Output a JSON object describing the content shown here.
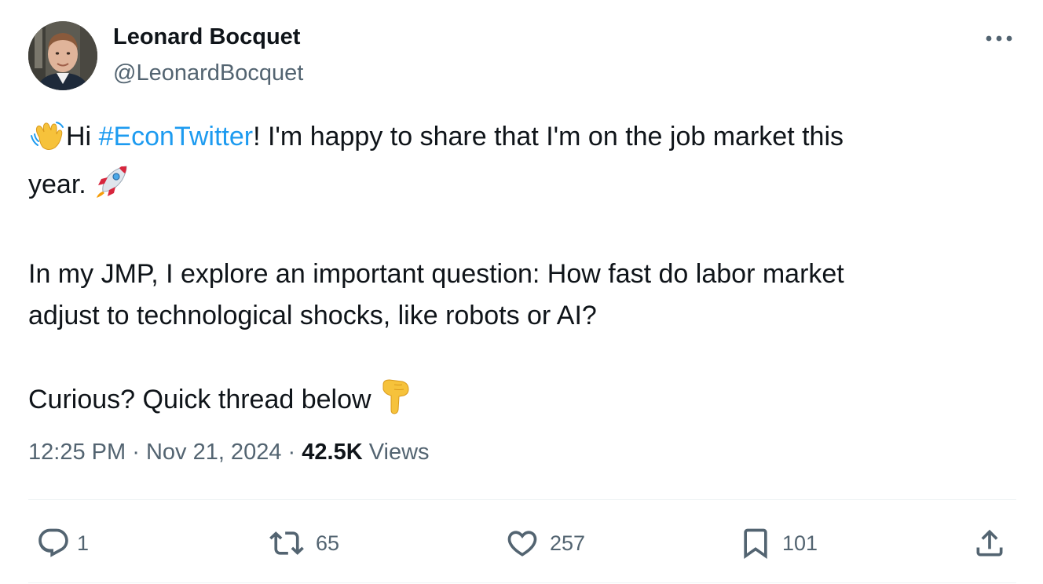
{
  "author": {
    "name": "Leonard Bocquet",
    "handle": "@LeonardBocquet",
    "avatar_icon": "profile-photo"
  },
  "tweet": {
    "line1_prefix": "Hi ",
    "hashtag": "#EconTwitter",
    "line1_suffix": "! I'm happy to share that I'm on the job market this",
    "line2": "year.",
    "para2_line1": "In my JMP, I explore an important question: How fast do labor market",
    "para2_line2": "adjust to technological shocks, like robots or AI?",
    "para3": "Curious? Quick thread below",
    "emojis": [
      "waving-hand",
      "rocket",
      "backhand-index-pointing-down"
    ]
  },
  "meta": {
    "time": "12:25 PM",
    "separator": "·",
    "date": "Nov 21, 2024",
    "views_count": "42.5K",
    "views_label": "Views"
  },
  "actions": {
    "reply_count": "1",
    "retweet_count": "65",
    "like_count": "257",
    "bookmark_count": "101"
  },
  "colors": {
    "text": "#0f1419",
    "secondary": "#536471",
    "link": "#1d9bf0",
    "divider": "#eff3f4"
  }
}
